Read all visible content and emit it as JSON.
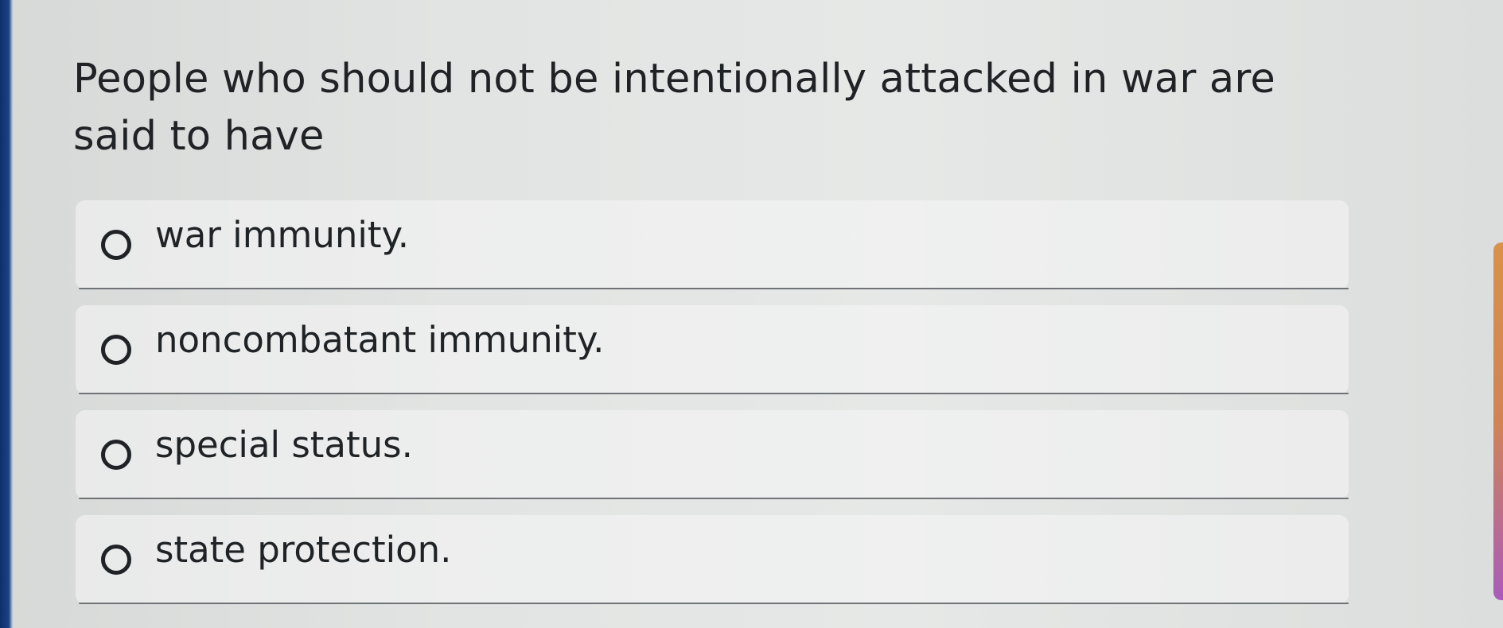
{
  "question": {
    "text": "People who should not be intentionally attacked in war are said to have"
  },
  "options": [
    {
      "label": "war immunity.",
      "selected": false
    },
    {
      "label": "noncombatant immunity.",
      "selected": false
    },
    {
      "label": "special status.",
      "selected": false
    },
    {
      "label": "state protection.",
      "selected": false
    }
  ]
}
